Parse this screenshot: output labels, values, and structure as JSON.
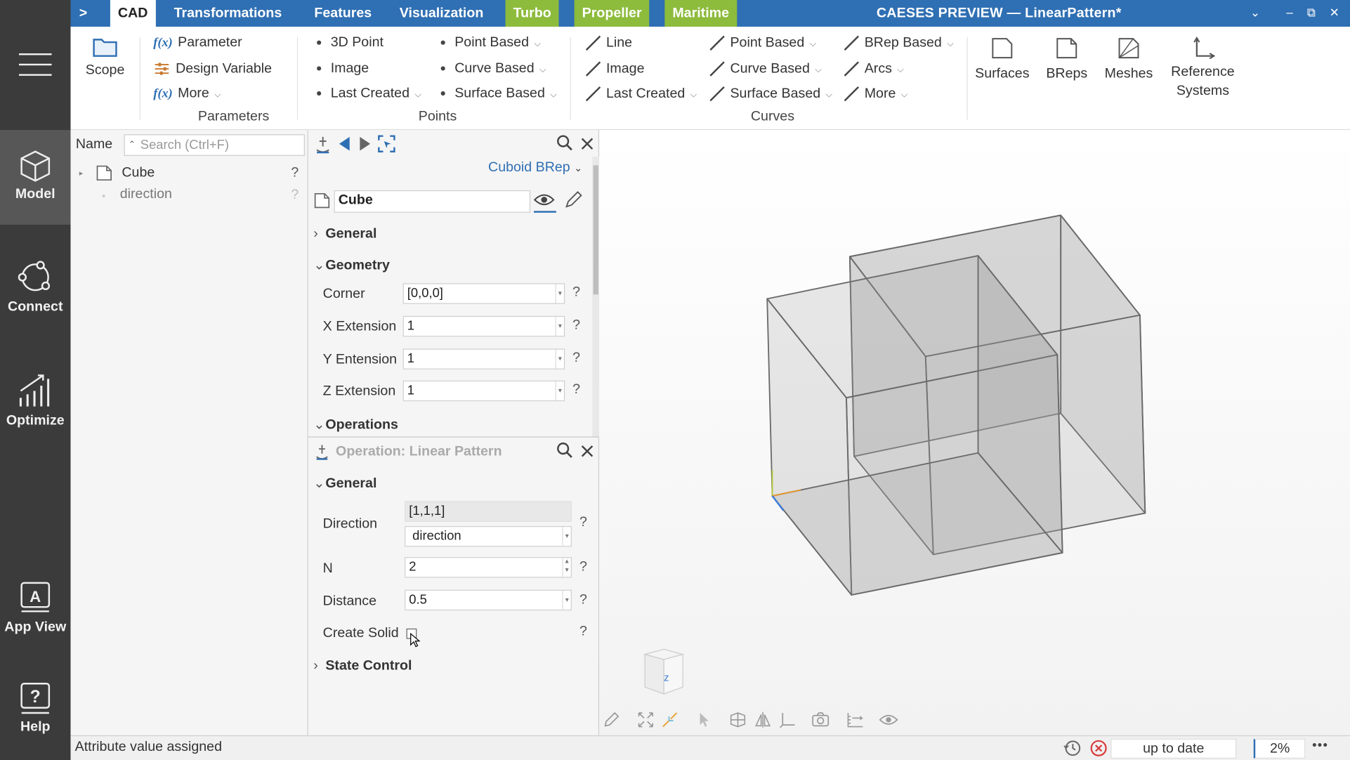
{
  "window": {
    "title": "CAESES PREVIEW — LinearPattern*",
    "tabs": [
      "CAD",
      "Transformations",
      "Features",
      "Visualization",
      "Turbo",
      "Propeller",
      "Maritime"
    ],
    "controls": {
      "collapse": "⌄",
      "minimize": "–",
      "restore": "⧉",
      "close": "✕"
    },
    "nav_arrow": ">"
  },
  "rail": {
    "items": [
      "Model",
      "Connect",
      "Optimize",
      "App View",
      "Help"
    ],
    "active": "Model"
  },
  "ribbon": {
    "scope": "Scope",
    "parameters": {
      "items": [
        "Parameter",
        "Design Variable",
        "More"
      ],
      "fx": "f(x)",
      "group": "Parameters"
    },
    "points": {
      "col1": [
        "3D Point",
        "Image",
        "Last Created"
      ],
      "col2": [
        "Point Based",
        "Curve Based",
        "Surface Based"
      ],
      "group": "Points"
    },
    "curves": {
      "col1": [
        "Line",
        "Image",
        "Last Created"
      ],
      "col2": [
        "Point Based",
        "Curve Based",
        "Surface Based"
      ],
      "col3": [
        "BRep Based",
        "Arcs",
        "More"
      ],
      "group": "Curves"
    },
    "big": [
      "Surfaces",
      "BReps",
      "Meshes",
      "Reference",
      "Systems"
    ]
  },
  "tree": {
    "name_label": "Name",
    "search_placeholder": "Search (Ctrl+F)",
    "nodes": [
      {
        "label": "Cube",
        "help": "?"
      },
      {
        "label": "direction",
        "help": "?"
      }
    ]
  },
  "props": {
    "type_selector": "Cuboid BRep",
    "object_name": "Cube",
    "sections": [
      "General",
      "Geometry",
      "Operations"
    ],
    "fields": [
      {
        "label": "Corner",
        "value": "[0,0,0]"
      },
      {
        "label": "X Extension",
        "value": "1"
      },
      {
        "label": "Y Entension",
        "value": "1"
      },
      {
        "label": "Z Extension",
        "value": "1"
      }
    ],
    "help": "?"
  },
  "operation": {
    "title": "Operation: Linear Pattern",
    "sections": [
      "General",
      "State Control"
    ],
    "direction": {
      "label": "Direction",
      "value": "[1,1,1]",
      "ref": "direction"
    },
    "n": {
      "label": "N",
      "value": "2"
    },
    "distance": {
      "label": "Distance",
      "value": "0.5"
    },
    "create_solid": {
      "label": "Create Solid",
      "checked": false
    }
  },
  "viewport": {
    "cube_face": "z"
  },
  "status": {
    "message": "Attribute value assigned",
    "state": "up to date",
    "percent": "2%",
    "more": "•••"
  },
  "colors": {
    "rail": "#3b3b3b",
    "topbar": "#2f6fb3",
    "green_tab": "#8dbb3c",
    "accent": "#2f6fb3"
  }
}
